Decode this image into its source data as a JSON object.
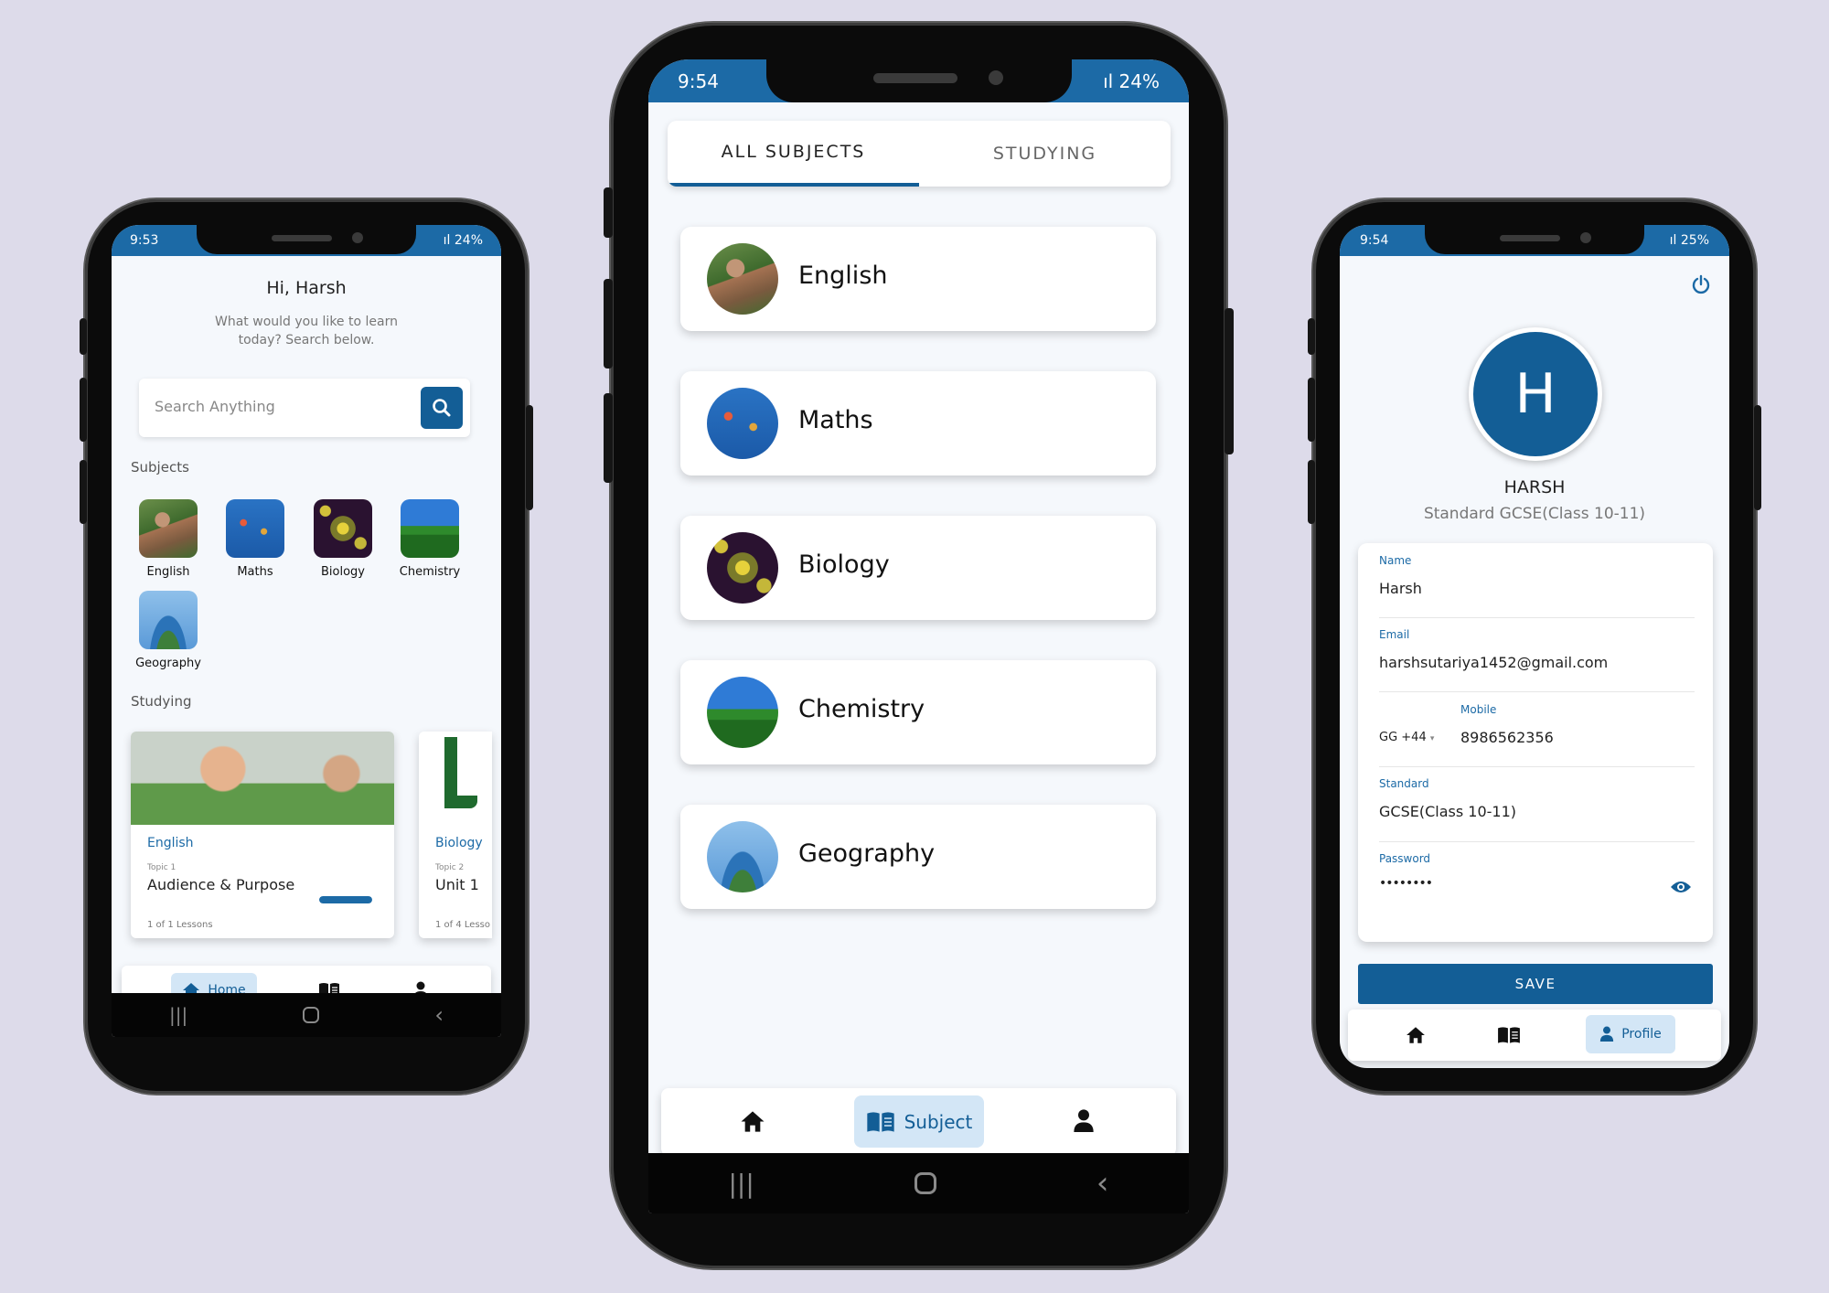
{
  "colors": {
    "primary": "#135e96",
    "status": "#1c6aa6",
    "bg": "#dddbea"
  },
  "home": {
    "status": {
      "time": "9:53",
      "battery": "24%"
    },
    "greeting": "Hi, Harsh",
    "subtitle_line1": "What would you like to learn",
    "subtitle_line2": "today? Search below.",
    "search_placeholder": "Search Anything",
    "subjects_heading": "Subjects",
    "subjects": [
      "English",
      "Maths",
      "Biology",
      "Chemistry",
      "Geography"
    ],
    "studying_heading": "Studying",
    "studying": [
      {
        "subject": "English",
        "topic": "Topic 1",
        "title": "Audience & Purpose",
        "lessons": "1 of 1 Lessons",
        "progress": 0.35
      },
      {
        "subject": "Biology",
        "topic": "Topic 2",
        "title": "Unit 1",
        "lessons": "1 of 4 Lesso"
      }
    ],
    "nav": {
      "home": "Home"
    }
  },
  "subjects_screen": {
    "status": {
      "time": "9:54",
      "battery": "24%"
    },
    "tabs": [
      "ALL SUBJECTS",
      "STUDYING"
    ],
    "subjects": [
      "English",
      "Maths",
      "Biology",
      "Chemistry",
      "Geography"
    ],
    "nav": {
      "subject": "Subject"
    }
  },
  "profile": {
    "status": {
      "time": "9:54",
      "battery": "25%"
    },
    "initial": "H",
    "name_caps": "HARSH",
    "standard_line": "Standard GCSE(Class 10-11)",
    "fields": {
      "name_label": "Name",
      "name_value": "Harsh",
      "email_label": "Email",
      "email_value": "harshsutariya1452@gmail.com",
      "mobile_label": "Mobile",
      "country_code": "GG +44",
      "mobile_value": "8986562356",
      "standard_label": "Standard",
      "standard_value": "GCSE(Class 10-11)",
      "password_label": "Password",
      "password_value": "••••••••"
    },
    "save": "SAVE",
    "nav": {
      "profile": "Profile"
    }
  }
}
